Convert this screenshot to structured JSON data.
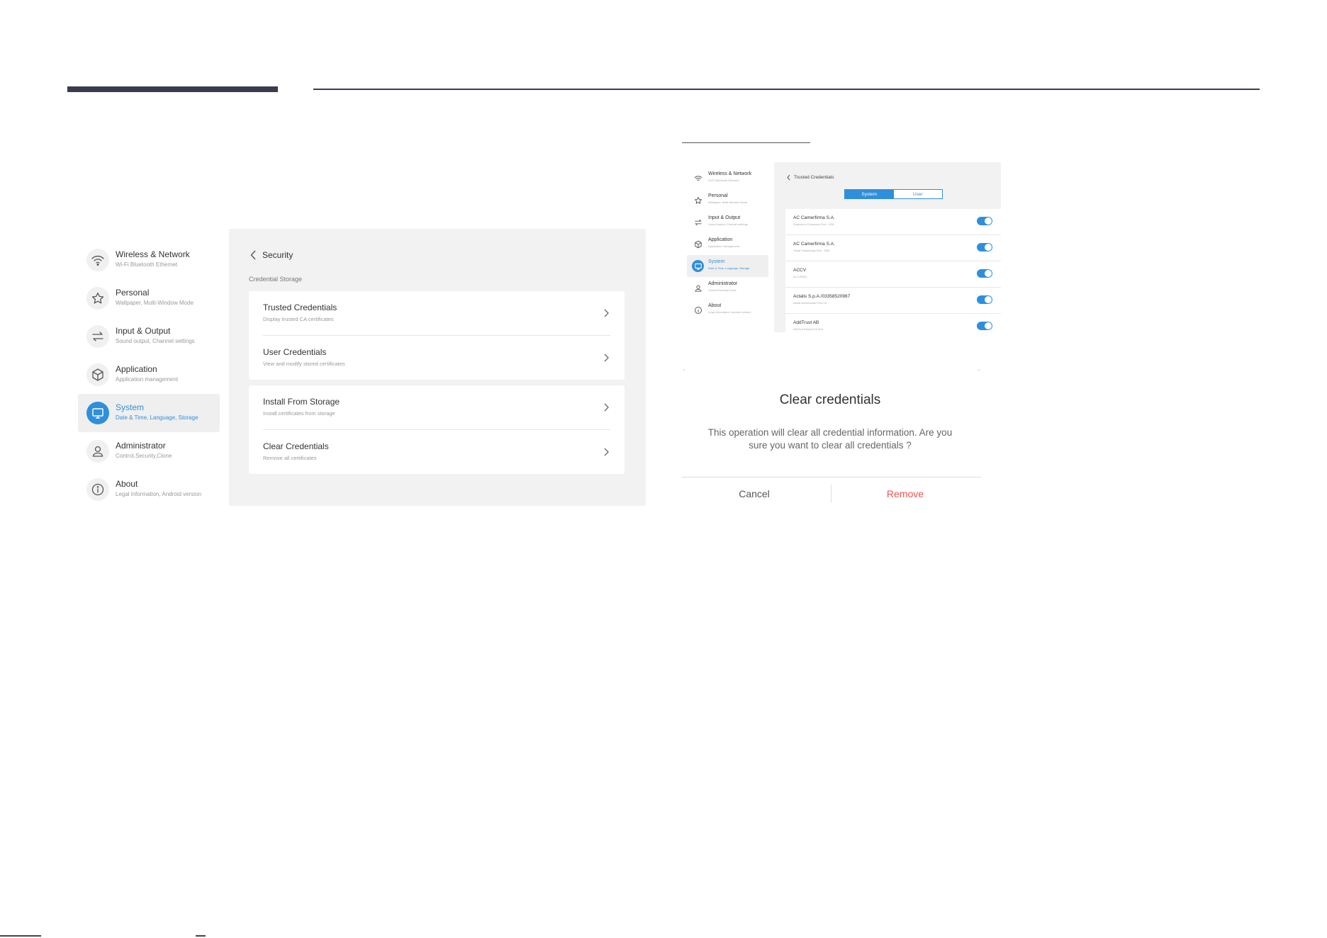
{
  "left_panel": {
    "sidebar": [
      {
        "title": "Wireless & Network",
        "sub": "Wi-Fi Bluetooth Ethernet",
        "icon": "wifi-icon"
      },
      {
        "title": "Personal",
        "sub": "Wallpaper, Multi-Window Mode",
        "icon": "star-icon"
      },
      {
        "title": "Input & Output",
        "sub": "Sound output, Channel settings",
        "icon": "swap-arrows-icon"
      },
      {
        "title": "Application",
        "sub": "Application management",
        "icon": "cube-icon"
      },
      {
        "title": "System",
        "sub": "Date & Time, Language, Storage",
        "icon": "monitor-icon",
        "active": true
      },
      {
        "title": "Administrator",
        "sub": "Control,Security,Clone",
        "icon": "user-icon"
      },
      {
        "title": "About",
        "sub": "Legal information, Android version",
        "icon": "info-icon"
      }
    ],
    "page_title": "Security",
    "section_label": "Credential Storage",
    "group1": [
      {
        "title": "Trusted Credentials",
        "sub": "Display trusted CA certificates"
      },
      {
        "title": "User Credentials",
        "sub": "View and modify stored certificates"
      }
    ],
    "group2": [
      {
        "title": "Install From Storage",
        "sub": "Install certificates from storage"
      },
      {
        "title": "Clear Credentials",
        "sub": "Remove all certificates"
      }
    ]
  },
  "right_panel": {
    "sidebar": [
      {
        "title": "Wireless & Network",
        "sub": "Wi-Fi Bluetooth Ethernet"
      },
      {
        "title": "Personal",
        "sub": "Wallpaper, Multi-Window Mode"
      },
      {
        "title": "Input & Output",
        "sub": "Sound output, Channel settings"
      },
      {
        "title": "Application",
        "sub": "Application management"
      },
      {
        "title": "System",
        "sub": "Date & Time, Language, Storage",
        "active": true
      },
      {
        "title": "Administrator",
        "sub": "Control,Security,Clone"
      },
      {
        "title": "About",
        "sub": "Legal information, Android version"
      }
    ],
    "page_title": "Trusted Credentials",
    "tabs": {
      "system": "System",
      "user": "User"
    },
    "credentials": [
      {
        "name": "AC Camerfirma S.A.",
        "sub": "Chambers of Commerce Root - 2008",
        "enabled": true
      },
      {
        "name": "AC Camerfirma S.A.",
        "sub": "Global Chambersign Root - 2008",
        "enabled": true
      },
      {
        "name": "ACCV",
        "sub": "ACCVRAIZ1",
        "enabled": true
      },
      {
        "name": "Actalis S.p.A./03358520967",
        "sub": "Actalis Authentication Root CA",
        "enabled": true
      },
      {
        "name": "AddTrust AB",
        "sub": "AddTrust External CA Root",
        "enabled": true
      }
    ],
    "dialog": {
      "title": "Clear credentials",
      "message": "This operation will clear all credential information. Are you sure you want to clear all credentials ?",
      "cancel": "Cancel",
      "remove": "Remove"
    }
  },
  "colors": {
    "accent": "#2f8fdb",
    "remove": "#ef5350",
    "header_bar": "#3a3b4f"
  }
}
